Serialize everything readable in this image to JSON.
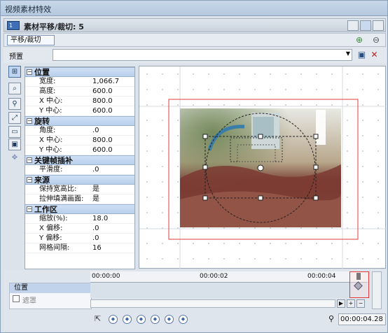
{
  "window": {
    "title": "视频素材特效"
  },
  "header": {
    "badge": "1",
    "title": "素材平移/裁切: 5"
  },
  "fx_tab": {
    "label": "平移/裁切"
  },
  "preset": {
    "label": "预置",
    "value": ""
  },
  "sections": [
    {
      "title": "位置",
      "rows": [
        {
          "key": "宽度:",
          "value": "1,066.7"
        },
        {
          "key": "高度:",
          "value": "600.0"
        },
        {
          "key": "X 中心:",
          "value": "800.0"
        },
        {
          "key": "Y 中心:",
          "value": "600.0"
        }
      ]
    },
    {
      "title": "旋转",
      "rows": [
        {
          "key": "角度:",
          "value": ".0"
        },
        {
          "key": "X 中心:",
          "value": "800.0"
        },
        {
          "key": "Y 中心:",
          "value": "600.0"
        }
      ]
    },
    {
      "title": "关键帧插补",
      "rows": [
        {
          "key": "平滑度:",
          "value": ".0"
        }
      ]
    },
    {
      "title": "来源",
      "rows": [
        {
          "key": "保持宽高比:",
          "value": "是"
        },
        {
          "key": "拉伸填满画面:",
          "value": "是"
        }
      ]
    },
    {
      "title": "工作区",
      "rows": [
        {
          "key": "缩放(%):",
          "value": "18.0"
        },
        {
          "key": "X 偏移:",
          "value": ".0"
        },
        {
          "key": "Y 偏移:",
          "value": ".0"
        },
        {
          "key": "网格间隔:",
          "value": "16"
        }
      ]
    }
  ],
  "timeline": {
    "ruler": [
      "00:00:00",
      "00:00:02",
      "00:00:04"
    ],
    "track_label": "位置",
    "mask_label": "遮罩",
    "time": "00:00:04.28"
  },
  "colors": {
    "frame_red": "#e23b3b",
    "section_bg": "#c3d7ef",
    "selected_track": "#c0d3ea"
  }
}
